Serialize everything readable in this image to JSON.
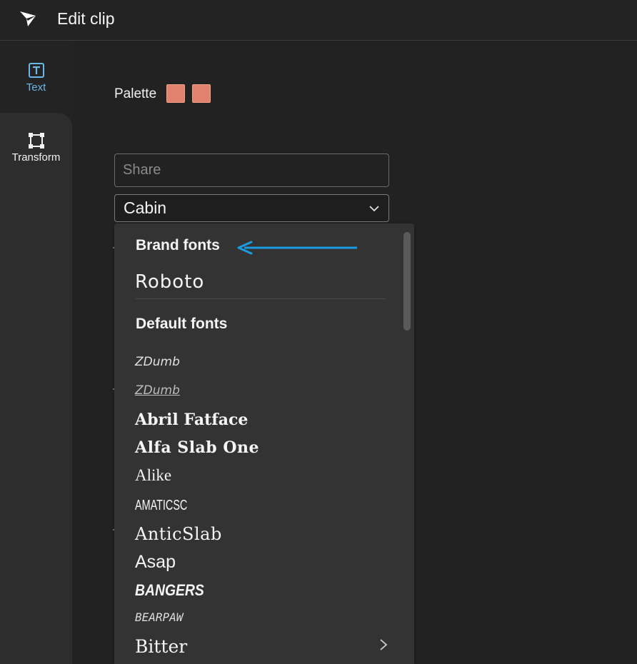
{
  "header": {
    "title": "Edit clip",
    "logo_icon": "paper-plane-logo-icon"
  },
  "sidebar": {
    "items": [
      {
        "label": "Text",
        "icon": "text-box-icon",
        "active": true
      },
      {
        "label": "Transform",
        "icon": "transform-frame-icon",
        "active": false
      }
    ]
  },
  "palette": {
    "label": "Palette",
    "colors": [
      "#e0826e",
      "#e0826e"
    ]
  },
  "share_input": {
    "placeholder": "Share",
    "value": ""
  },
  "font_select": {
    "value": "Cabin"
  },
  "dropdown": {
    "brand_header": "Brand fonts",
    "brand_fonts": [
      "Roboto"
    ],
    "default_header": "Default fonts",
    "default_fonts": [
      "ZDumb",
      "ZDumb",
      "Abril Fatface",
      "Alfa Slab One",
      "Alike",
      "AMATICSC",
      "AnticSlab",
      "Asap",
      "BANGERS",
      "BEARPAW",
      "Bitter"
    ]
  },
  "colors": {
    "accent": "#6ab7e8",
    "arrow": "#1a9be0"
  }
}
